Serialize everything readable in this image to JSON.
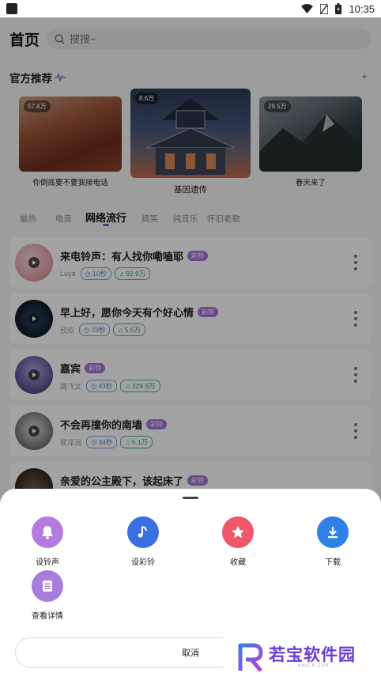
{
  "status_bar": {
    "time": "10:35"
  },
  "header": {
    "title": "首页",
    "search_placeholder": "搜搜~"
  },
  "recommend": {
    "title": "官方推荐",
    "items": [
      {
        "badge": "57.8万",
        "caption": "你倒底要不要我接电话"
      },
      {
        "badge": "8.6万",
        "caption": "基因遗传"
      },
      {
        "badge": "29.5万",
        "caption": "春天来了"
      }
    ]
  },
  "category_tabs": [
    "最热",
    "电音",
    "网络流行",
    "搞笑",
    "纯音乐",
    "怀旧老歌"
  ],
  "active_tab_index": 2,
  "songs": [
    {
      "title": "来电铃声：有人找你嘞嗑耶",
      "tag": "彩铃",
      "artist": "Luya",
      "duration": "10秒",
      "plays": "92.9万"
    },
    {
      "title": "早上好，愿你今天有个好心情",
      "tag": "彩铃",
      "artist": "欣欣",
      "duration": "23秒",
      "plays": "5.5万"
    },
    {
      "title": "嘉宾",
      "tag": "彩铃",
      "artist": "路飞文",
      "duration": "43秒",
      "plays": "329.9万"
    },
    {
      "title": "不会再撞你的南墙",
      "tag": "彩铃",
      "artist": "侯泽润",
      "duration": "34秒",
      "plays": "6.1万"
    },
    {
      "title": "亲爱的公主殿下，该起床了",
      "tag": "彩铃"
    }
  ],
  "sheet": {
    "actions": [
      {
        "label": "设铃声",
        "icon": "bell-icon",
        "color": "#b57be0"
      },
      {
        "label": "设彩铃",
        "icon": "music-note-icon",
        "color": "#3b6fe0"
      },
      {
        "label": "收藏",
        "icon": "star-icon",
        "color": "#f0556a"
      },
      {
        "label": "下载",
        "icon": "download-icon",
        "color": "#2f80e8"
      },
      {
        "label": "查看详情",
        "icon": "list-icon",
        "color": "#a77ede"
      }
    ],
    "cancel_label": "取消"
  },
  "watermark": {
    "text": "若宝软件园",
    "subtext": "RBSCN.COM"
  }
}
